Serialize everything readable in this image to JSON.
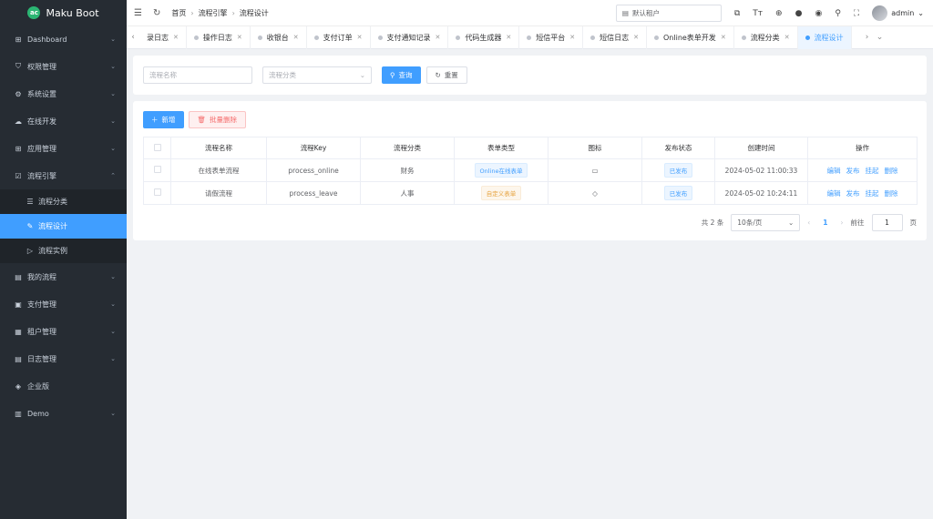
{
  "app": {
    "logo_mark": "ac",
    "name": "Maku Boot"
  },
  "sidebar": {
    "items": [
      {
        "label": "Dashboard",
        "icon": "grid-icon"
      },
      {
        "label": "权限管理",
        "icon": "shield-icon"
      },
      {
        "label": "系统设置",
        "icon": "gear-icon"
      },
      {
        "label": "在线开发",
        "icon": "cloud-icon"
      },
      {
        "label": "应用管理",
        "icon": "apps-icon"
      },
      {
        "label": "流程引擎",
        "icon": "workflow-icon",
        "expanded": true
      },
      {
        "label": "我的流程",
        "icon": "doc-icon"
      },
      {
        "label": "支付管理",
        "icon": "pay-icon"
      },
      {
        "label": "租户管理",
        "icon": "tenant-icon"
      },
      {
        "label": "日志管理",
        "icon": "log-icon"
      },
      {
        "label": "企业版",
        "icon": "diamond-icon"
      },
      {
        "label": "Demo",
        "icon": "demo-icon"
      }
    ],
    "sub": [
      {
        "label": "流程分类",
        "icon": "list-icon"
      },
      {
        "label": "流程设计",
        "icon": "design-icon",
        "active": true
      },
      {
        "label": "流程实例",
        "icon": "play-icon"
      }
    ]
  },
  "header": {
    "breadcrumb": [
      "首页",
      "流程引擎",
      "流程设计"
    ],
    "tenant": "默认租户",
    "user": "admin"
  },
  "tabs": [
    {
      "label": "录日志"
    },
    {
      "label": "操作日志"
    },
    {
      "label": "收银台"
    },
    {
      "label": "支付订单"
    },
    {
      "label": "支付通知记录"
    },
    {
      "label": "代码生成器"
    },
    {
      "label": "短信平台"
    },
    {
      "label": "短信日志"
    },
    {
      "label": "Online表单开发"
    },
    {
      "label": "流程分类"
    },
    {
      "label": "流程设计",
      "active": true
    }
  ],
  "search": {
    "name_placeholder": "流程名称",
    "category_placeholder": "流程分类",
    "query_label": "查询",
    "reset_label": "重置"
  },
  "toolbar": {
    "add_label": "新增",
    "batch_delete_label": "批量删除"
  },
  "table": {
    "columns": [
      "流程名称",
      "流程Key",
      "流程分类",
      "表单类型",
      "图标",
      "发布状态",
      "创建时间",
      "操作"
    ],
    "rows": [
      {
        "name": "在线表单流程",
        "key": "process_online",
        "category": "财务",
        "form_type": "Online在线表单",
        "form_color": "blue",
        "icon": "window-icon",
        "status": "已发布",
        "created": "2024-05-02 11:00:33"
      },
      {
        "name": "请假流程",
        "key": "process_leave",
        "category": "人事",
        "form_type": "自定义表单",
        "form_color": "orange",
        "icon": "tag-icon",
        "status": "已发布",
        "created": "2024-05-02 10:24:11"
      }
    ],
    "actions": [
      "编辑",
      "发布",
      "挂起",
      "删除"
    ]
  },
  "pagination": {
    "total_text": "共 2 条",
    "page_size": "10条/页",
    "current": "1",
    "goto_label": "前往",
    "goto_value": "1",
    "page_suffix": "页"
  },
  "colors": {
    "primary": "#409eff",
    "sidebar_bg": "#262c33",
    "logo_green": "#2bb673"
  }
}
